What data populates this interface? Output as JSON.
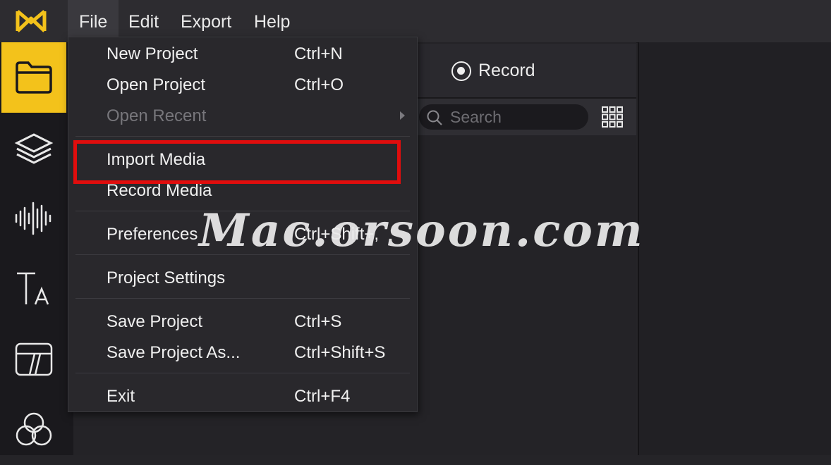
{
  "menubar": {
    "items": [
      {
        "label": "File",
        "active": true
      },
      {
        "label": "Edit"
      },
      {
        "label": "Export"
      },
      {
        "label": "Help"
      }
    ]
  },
  "sidebar": {
    "items": [
      {
        "icon": "folder-icon",
        "active": true
      },
      {
        "icon": "layers-icon"
      },
      {
        "icon": "audio-waveform-icon"
      },
      {
        "icon": "text-icon"
      },
      {
        "icon": "transition-icon"
      },
      {
        "icon": "effects-icon"
      }
    ]
  },
  "record": {
    "label": "Record"
  },
  "search": {
    "placeholder": "Search",
    "value": ""
  },
  "file_menu": {
    "items": [
      {
        "label": "New Project",
        "shortcut": "Ctrl+N"
      },
      {
        "label": "Open Project",
        "shortcut": "Ctrl+O"
      },
      {
        "label": "Open Recent",
        "shortcut": "",
        "disabled": true,
        "submenu": true
      },
      {
        "label": "Import Media",
        "shortcut": "",
        "highlighted": true
      },
      {
        "label": "Record Media",
        "shortcut": ""
      },
      {
        "label": "Preferences",
        "shortcut": "Ctrl+Shift+,"
      },
      {
        "label": "Project Settings",
        "shortcut": ""
      },
      {
        "label": "Save Project",
        "shortcut": "Ctrl+S"
      },
      {
        "label": "Save Project As...",
        "shortcut": "Ctrl+Shift+S"
      },
      {
        "label": "Exit",
        "shortcut": "Ctrl+F4"
      }
    ]
  },
  "watermark": {
    "text": "Mac.orsoon.com"
  },
  "colors": {
    "accent": "#f3c21b",
    "highlight": "#e00d0d",
    "background": "#252428"
  }
}
